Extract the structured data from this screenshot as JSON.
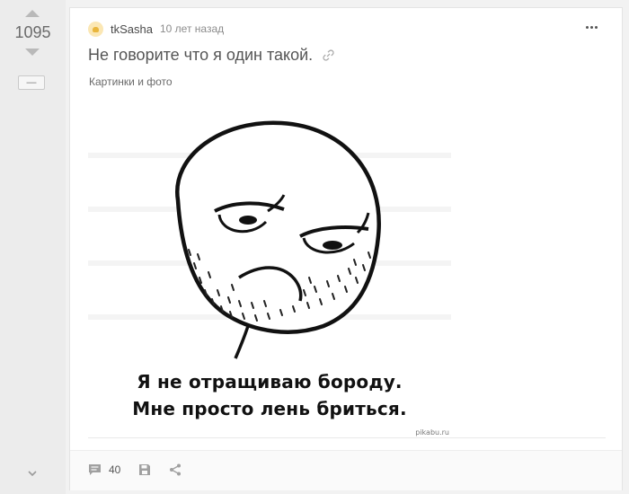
{
  "rating": {
    "value": "1095",
    "hide_label": "—"
  },
  "story": {
    "author": "tkSasha",
    "time": "10 лет назад",
    "title": "Не говорите что я один такой.",
    "tag": "Картинки и фото",
    "image": {
      "caption_line1": "Я не отращиваю бороду.",
      "caption_line2": "Мне просто лень бриться.",
      "watermark": "pikabu.ru"
    },
    "footer": {
      "comments_count": "40"
    }
  },
  "icons": {
    "up": "arrow-up-icon",
    "down": "arrow-down-icon",
    "link": "link-icon",
    "more": "more-dots-icon",
    "comments": "comment-icon",
    "save": "floppy-save-icon",
    "share": "share-icon",
    "collapse": "chevron-down-icon"
  },
  "colors": {
    "page_bg": "#f2f2f2",
    "card_bg": "#ffffff",
    "text_muted": "#8c8c8c",
    "icon_gray": "#a0a0a0"
  }
}
